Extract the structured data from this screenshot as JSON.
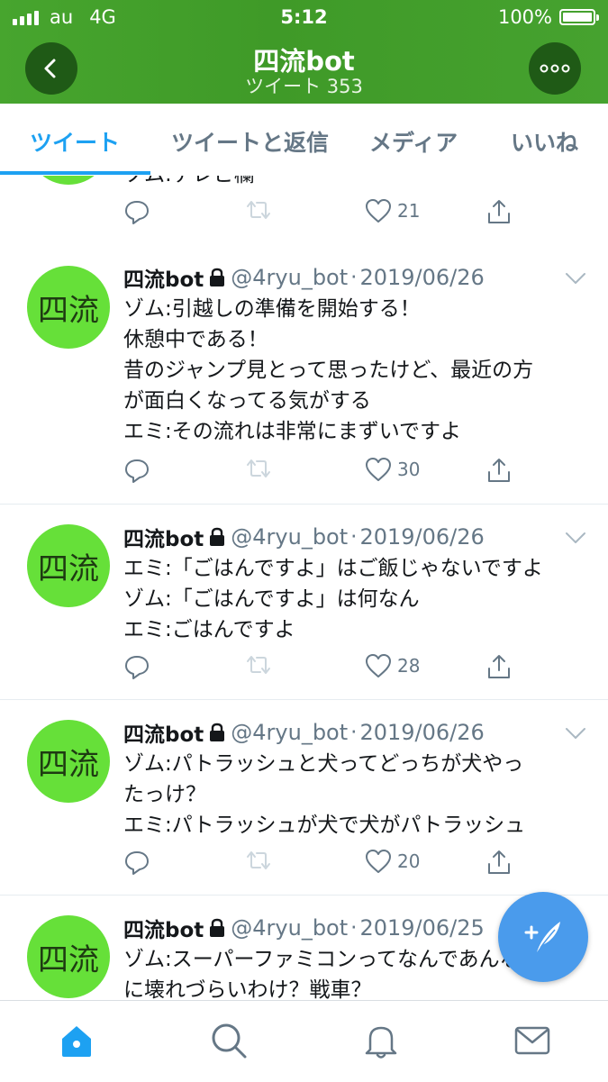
{
  "status_bar": {
    "carrier": "au",
    "network": "4G",
    "time": "5:12",
    "battery": "100%",
    "battery_level": 1.0
  },
  "header": {
    "title": "四流bot",
    "subtitle": "ツイート 353",
    "back_icon": "chevron-left-icon",
    "more_icon": "more-dots-icon"
  },
  "tabs": [
    {
      "label": "ツイート",
      "active": true
    },
    {
      "label": "ツイートと返信",
      "active": false
    },
    {
      "label": "メディア",
      "active": false
    },
    {
      "label": "いいね",
      "active": false
    }
  ],
  "tweets": [
    {
      "name": "",
      "handle": "",
      "date": "",
      "lines": [
        "ゾム:テレビ欄"
      ],
      "reply_count": "",
      "retweet_count": "",
      "like_count": "21"
    },
    {
      "avatar_text": "四流",
      "name": "四流bot",
      "handle": "@4ryu_bot",
      "dot": "·",
      "date": "2019/06/26",
      "lines": [
        "ゾム:引越しの準備を開始する！",
        "休憩中である！",
        "昔のジャンプ見とって思ったけど、最近の方",
        "が面白くなってる気がする",
        "エミ:その流れは非常にまずいですよ"
      ],
      "like_count": "30"
    },
    {
      "avatar_text": "四流",
      "name": "四流bot",
      "handle": "@4ryu_bot",
      "dot": "·",
      "date": "2019/06/26",
      "lines": [
        "エミ:「ごはんですよ」はご飯じゃないですよ",
        "ゾム:「ごはんですよ」は何なん",
        "エミ:ごはんですよ"
      ],
      "like_count": "28"
    },
    {
      "avatar_text": "四流",
      "name": "四流bot",
      "handle": "@4ryu_bot",
      "dot": "·",
      "date": "2019/06/26",
      "lines": [
        "ゾム:パトラッシュと犬ってどっちが犬やっ",
        "たっけ？",
        "エミ:パトラッシュが犬で犬がパトラッシュ"
      ],
      "like_count": "20"
    },
    {
      "avatar_text": "四流",
      "name": "四流bot",
      "handle": "@4ryu_bot",
      "dot": "·",
      "date": "2019/06/25",
      "lines": [
        "ゾム:スーパーファミコンってなんであんな",
        "に壊れづらいわけ？戦車？"
      ],
      "like_count": ""
    }
  ],
  "fab": {
    "icon": "compose-tweet-icon"
  },
  "bottom_nav": [
    {
      "icon": "home-icon",
      "active": true
    },
    {
      "icon": "search-icon",
      "active": false
    },
    {
      "icon": "notifications-bell-icon",
      "active": false
    },
    {
      "icon": "messages-envelope-icon",
      "active": false
    }
  ],
  "colors": {
    "header_green": "#43a02c",
    "accent_blue": "#1da1f2",
    "avatar_green": "#66e039",
    "text_gray": "#657786",
    "fab_blue": "#4a9bec"
  }
}
